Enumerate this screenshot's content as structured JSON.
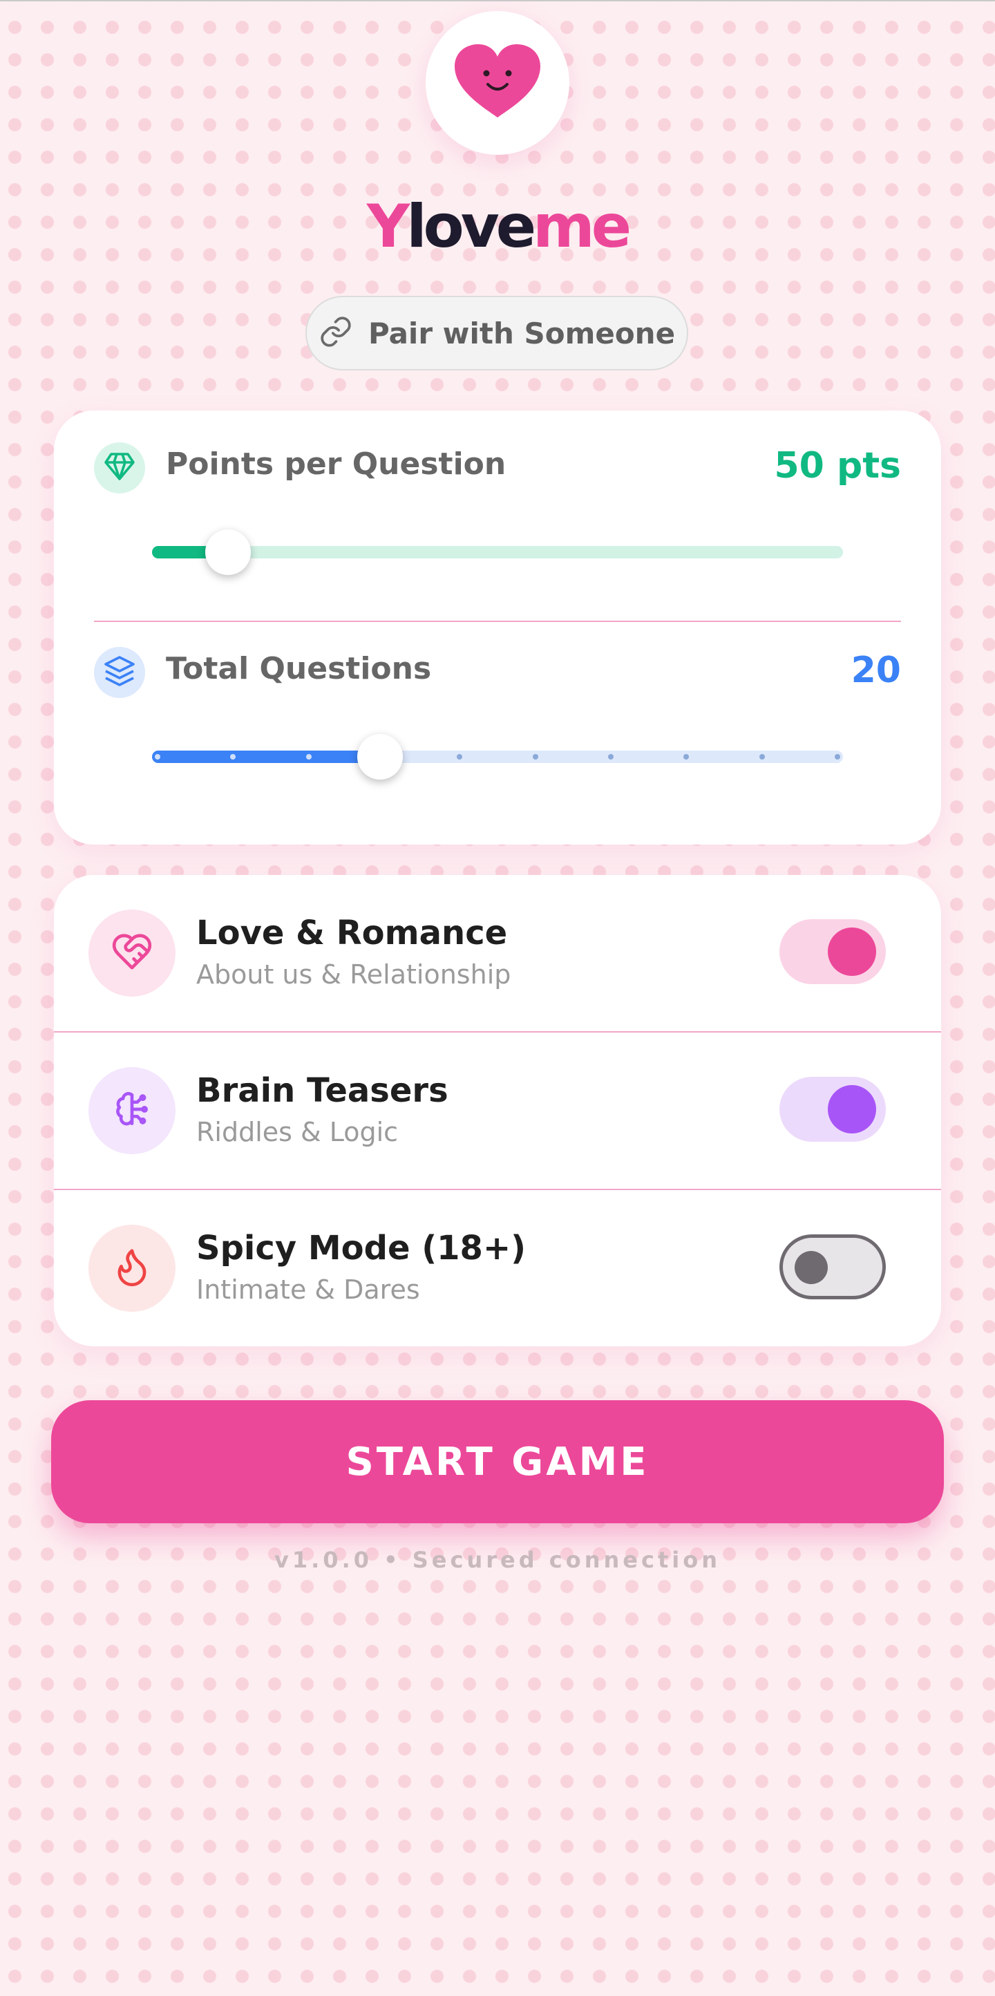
{
  "app": {
    "brand_parts": [
      "Y",
      "love",
      "me"
    ],
    "accent_color": "#ec4899",
    "logo_icon": "smiling-heart-icon"
  },
  "pair_button": {
    "label": "Pair with Someone",
    "icon": "link-icon"
  },
  "settings": {
    "points": {
      "label": "Points per Question",
      "value_text": "50 pts",
      "icon": "diamond-icon",
      "color": "#10b981",
      "slider_fraction": 0.11
    },
    "questions": {
      "label": "Total Questions",
      "value_text": "20",
      "icon": "layers-icon",
      "color": "#3b82f6",
      "slider_fraction": 0.33,
      "step_count": 9
    }
  },
  "modes": [
    {
      "title": "Love & Romance",
      "subtitle": "About us & Relationship",
      "icon": "heart-handshake-icon",
      "color": "#ec4899",
      "enabled": true
    },
    {
      "title": "Brain Teasers",
      "subtitle": "Riddles & Logic",
      "icon": "brain-icon",
      "color": "#a855f7",
      "enabled": true
    },
    {
      "title": "Spicy Mode (18+)",
      "subtitle": "Intimate & Dares",
      "icon": "flame-icon",
      "color": "#ef4444",
      "enabled": false
    }
  ],
  "start_button": {
    "label": "START GAME"
  },
  "footer": {
    "text": "v1.0.0 • Secured connection"
  }
}
